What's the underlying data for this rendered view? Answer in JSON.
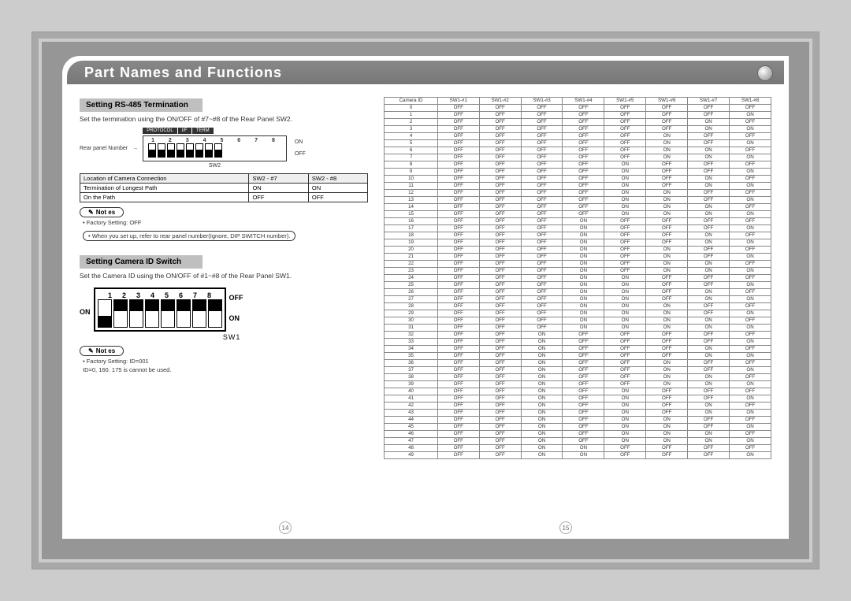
{
  "title": "Part Names and Functions",
  "section1": {
    "heading": "Setting RS-485 Termination",
    "desc": "Set the termination using the ON/OFF of #7~#8 of the Rear Panel SW2.",
    "rear_label": "Rear panel Number",
    "legend": [
      "PROTOCOL",
      "I/F",
      "TERM"
    ],
    "nums": "1  2  3  4  5  6  7  8",
    "on": "ON",
    "off": "OFF",
    "sw_label": "SW2",
    "table": {
      "headers": [
        "Location of Camera Connection",
        "SW2 - #7",
        "SW2 - #8"
      ],
      "rows": [
        [
          "Termination of Longest Path",
          "ON",
          "ON"
        ],
        [
          "On the Path",
          "OFF",
          "OFF"
        ]
      ]
    }
  },
  "notes1": {
    "label": "Not es",
    "line1": "• Factory Setting: OFF",
    "line2": "• When you set up, refer to rear panel number(Ignore, DIP SWITCH number)."
  },
  "section2": {
    "heading": "Setting Camera ID Switch",
    "desc": "Set the Camera ID using the ON/OFF of #1~#8 of the Rear Panel SW1.",
    "nums": [
      "1",
      "2",
      "3",
      "4",
      "5",
      "6",
      "7",
      "8"
    ],
    "off": "OFF",
    "on": "ON",
    "sw_label": "SW1",
    "sw1_state": [
      "down",
      "up",
      "up",
      "up",
      "up",
      "up",
      "up",
      "up"
    ]
  },
  "notes2": {
    "label": "Not es",
    "line1": "• Factory Setting: ID=001",
    "line2": "ID=0, 160. 175 is cannot be used."
  },
  "pages": {
    "left": "14",
    "right": "15"
  },
  "chart_data": {
    "type": "table",
    "title": "Camera ID DIP switch settings (SW1-#1..#8)",
    "columns": [
      "Camera ID",
      "SW1-#1",
      "SW1-#2",
      "SW1-#3",
      "SW1-#4",
      "SW1-#5",
      "SW1-#6",
      "SW1-#7",
      "SW1-#8"
    ],
    "rows": [
      [
        0,
        "OFF",
        "OFF",
        "OFF",
        "OFF",
        "OFF",
        "OFF",
        "OFF",
        "OFF"
      ],
      [
        1,
        "OFF",
        "OFF",
        "OFF",
        "OFF",
        "OFF",
        "OFF",
        "OFF",
        "ON"
      ],
      [
        2,
        "OFF",
        "OFF",
        "OFF",
        "OFF",
        "OFF",
        "OFF",
        "ON",
        "OFF"
      ],
      [
        3,
        "OFF",
        "OFF",
        "OFF",
        "OFF",
        "OFF",
        "OFF",
        "ON",
        "ON"
      ],
      [
        4,
        "OFF",
        "OFF",
        "OFF",
        "OFF",
        "OFF",
        "ON",
        "OFF",
        "OFF"
      ],
      [
        5,
        "OFF",
        "OFF",
        "OFF",
        "OFF",
        "OFF",
        "ON",
        "OFF",
        "ON"
      ],
      [
        6,
        "OFF",
        "OFF",
        "OFF",
        "OFF",
        "OFF",
        "ON",
        "ON",
        "OFF"
      ],
      [
        7,
        "OFF",
        "OFF",
        "OFF",
        "OFF",
        "OFF",
        "ON",
        "ON",
        "ON"
      ],
      [
        8,
        "OFF",
        "OFF",
        "OFF",
        "OFF",
        "ON",
        "OFF",
        "OFF",
        "OFF"
      ],
      [
        9,
        "OFF",
        "OFF",
        "OFF",
        "OFF",
        "ON",
        "OFF",
        "OFF",
        "ON"
      ],
      [
        10,
        "OFF",
        "OFF",
        "OFF",
        "OFF",
        "ON",
        "OFF",
        "ON",
        "OFF"
      ],
      [
        11,
        "OFF",
        "OFF",
        "OFF",
        "OFF",
        "ON",
        "OFF",
        "ON",
        "ON"
      ],
      [
        12,
        "OFF",
        "OFF",
        "OFF",
        "OFF",
        "ON",
        "ON",
        "OFF",
        "OFF"
      ],
      [
        13,
        "OFF",
        "OFF",
        "OFF",
        "OFF",
        "ON",
        "ON",
        "OFF",
        "ON"
      ],
      [
        14,
        "OFF",
        "OFF",
        "OFF",
        "OFF",
        "ON",
        "ON",
        "ON",
        "OFF"
      ],
      [
        15,
        "OFF",
        "OFF",
        "OFF",
        "OFF",
        "ON",
        "ON",
        "ON",
        "ON"
      ],
      [
        16,
        "OFF",
        "OFF",
        "OFF",
        "ON",
        "OFF",
        "OFF",
        "OFF",
        "OFF"
      ],
      [
        17,
        "OFF",
        "OFF",
        "OFF",
        "ON",
        "OFF",
        "OFF",
        "OFF",
        "ON"
      ],
      [
        18,
        "OFF",
        "OFF",
        "OFF",
        "ON",
        "OFF",
        "OFF",
        "ON",
        "OFF"
      ],
      [
        19,
        "OFF",
        "OFF",
        "OFF",
        "ON",
        "OFF",
        "OFF",
        "ON",
        "ON"
      ],
      [
        20,
        "OFF",
        "OFF",
        "OFF",
        "ON",
        "OFF",
        "ON",
        "OFF",
        "OFF"
      ],
      [
        21,
        "OFF",
        "OFF",
        "OFF",
        "ON",
        "OFF",
        "ON",
        "OFF",
        "ON"
      ],
      [
        22,
        "OFF",
        "OFF",
        "OFF",
        "ON",
        "OFF",
        "ON",
        "ON",
        "OFF"
      ],
      [
        23,
        "OFF",
        "OFF",
        "OFF",
        "ON",
        "OFF",
        "ON",
        "ON",
        "ON"
      ],
      [
        24,
        "OFF",
        "OFF",
        "OFF",
        "ON",
        "ON",
        "OFF",
        "OFF",
        "OFF"
      ],
      [
        25,
        "OFF",
        "OFF",
        "OFF",
        "ON",
        "ON",
        "OFF",
        "OFF",
        "ON"
      ],
      [
        26,
        "OFF",
        "OFF",
        "OFF",
        "ON",
        "ON",
        "OFF",
        "ON",
        "OFF"
      ],
      [
        27,
        "OFF",
        "OFF",
        "OFF",
        "ON",
        "ON",
        "OFF",
        "ON",
        "ON"
      ],
      [
        28,
        "OFF",
        "OFF",
        "OFF",
        "ON",
        "ON",
        "ON",
        "OFF",
        "OFF"
      ],
      [
        29,
        "OFF",
        "OFF",
        "OFF",
        "ON",
        "ON",
        "ON",
        "OFF",
        "ON"
      ],
      [
        30,
        "OFF",
        "OFF",
        "OFF",
        "ON",
        "ON",
        "ON",
        "ON",
        "OFF"
      ],
      [
        31,
        "OFF",
        "OFF",
        "OFF",
        "ON",
        "ON",
        "ON",
        "ON",
        "ON"
      ],
      [
        32,
        "OFF",
        "OFF",
        "ON",
        "OFF",
        "OFF",
        "OFF",
        "OFF",
        "OFF"
      ],
      [
        33,
        "OFF",
        "OFF",
        "ON",
        "OFF",
        "OFF",
        "OFF",
        "OFF",
        "ON"
      ],
      [
        34,
        "OFF",
        "OFF",
        "ON",
        "OFF",
        "OFF",
        "OFF",
        "ON",
        "OFF"
      ],
      [
        35,
        "OFF",
        "OFF",
        "ON",
        "OFF",
        "OFF",
        "OFF",
        "ON",
        "ON"
      ],
      [
        36,
        "OFF",
        "OFF",
        "ON",
        "OFF",
        "OFF",
        "ON",
        "OFF",
        "OFF"
      ],
      [
        37,
        "OFF",
        "OFF",
        "ON",
        "OFF",
        "OFF",
        "ON",
        "OFF",
        "ON"
      ],
      [
        38,
        "OFF",
        "OFF",
        "ON",
        "OFF",
        "OFF",
        "ON",
        "ON",
        "OFF"
      ],
      [
        39,
        "OFF",
        "OFF",
        "ON",
        "OFF",
        "OFF",
        "ON",
        "ON",
        "ON"
      ],
      [
        40,
        "OFF",
        "OFF",
        "ON",
        "OFF",
        "ON",
        "OFF",
        "OFF",
        "OFF"
      ],
      [
        41,
        "OFF",
        "OFF",
        "ON",
        "OFF",
        "ON",
        "OFF",
        "OFF",
        "ON"
      ],
      [
        42,
        "OFF",
        "OFF",
        "ON",
        "OFF",
        "ON",
        "OFF",
        "ON",
        "OFF"
      ],
      [
        43,
        "OFF",
        "OFF",
        "ON",
        "OFF",
        "ON",
        "OFF",
        "ON",
        "ON"
      ],
      [
        44,
        "OFF",
        "OFF",
        "ON",
        "OFF",
        "ON",
        "ON",
        "OFF",
        "OFF"
      ],
      [
        45,
        "OFF",
        "OFF",
        "ON",
        "OFF",
        "ON",
        "ON",
        "OFF",
        "ON"
      ],
      [
        46,
        "OFF",
        "OFF",
        "ON",
        "OFF",
        "ON",
        "ON",
        "ON",
        "OFF"
      ],
      [
        47,
        "OFF",
        "OFF",
        "ON",
        "OFF",
        "ON",
        "ON",
        "ON",
        "ON"
      ],
      [
        48,
        "OFF",
        "OFF",
        "ON",
        "ON",
        "OFF",
        "OFF",
        "OFF",
        "OFF"
      ],
      [
        49,
        "OFF",
        "OFF",
        "ON",
        "ON",
        "OFF",
        "OFF",
        "OFF",
        "ON"
      ]
    ]
  }
}
